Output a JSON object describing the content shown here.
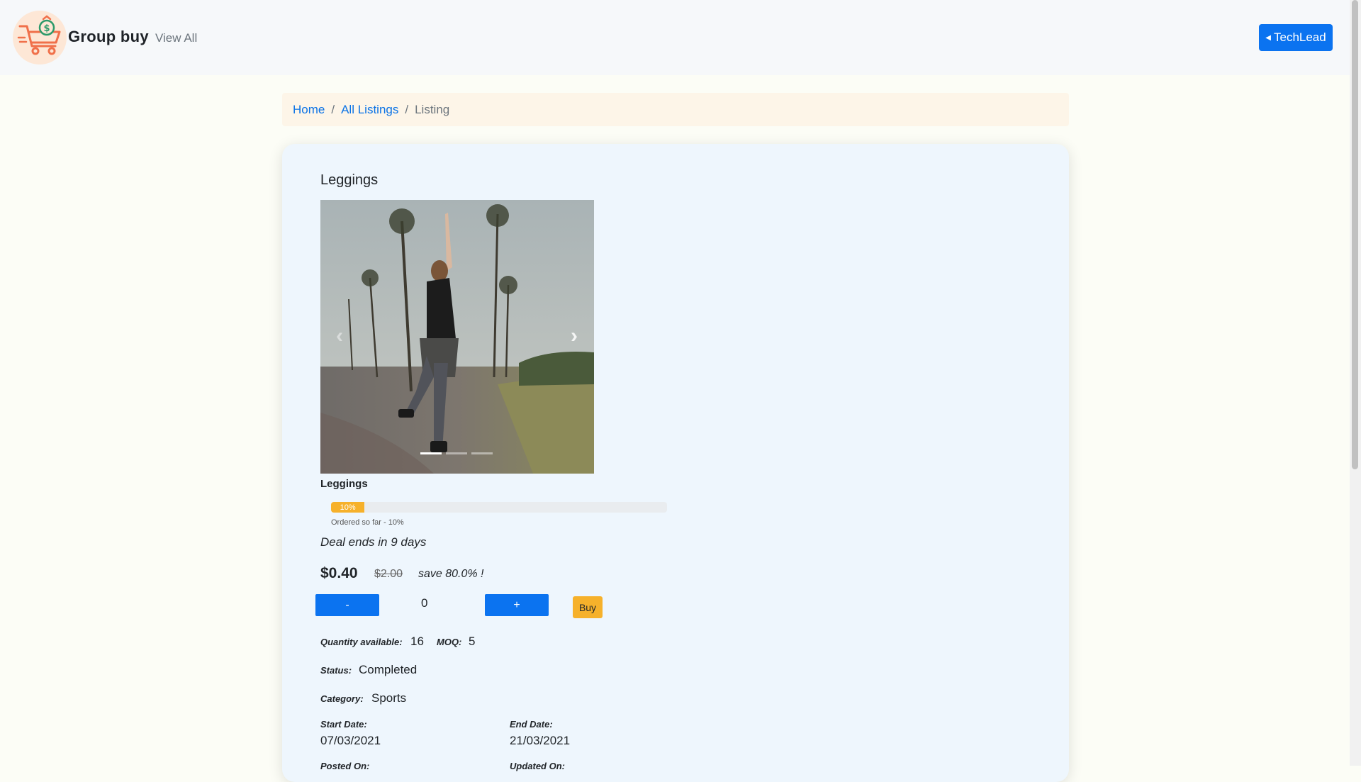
{
  "navbar": {
    "brand": "Group buy",
    "view_all": "View All",
    "user_button": "TechLead",
    "logo_icon": "shopping-cart-money-icon"
  },
  "breadcrumb": {
    "home": "Home",
    "all_listings": "All Listings",
    "current": "Listing",
    "separator": "/"
  },
  "listing": {
    "title": "Leggings",
    "product_name": "Leggings",
    "progress_percent": 10,
    "progress_label": "10%",
    "progress_caption": "Ordered so far - 10%",
    "deal_ends": "Deal ends in 9 days",
    "price": "$0.40",
    "original_price": "$2.00",
    "savings": "save 80.0% !",
    "quantity": "0",
    "minus_label": "-",
    "plus_label": "+",
    "buy_label": "Buy",
    "carousel": {
      "slide_count": 3,
      "active_slide": 0,
      "prev_icon": "chevron-left-icon",
      "next_icon": "chevron-right-icon"
    },
    "details": {
      "quantity_available_label": "Quantity available:",
      "quantity_available": "16",
      "moq_label": "MOQ:",
      "moq": "5",
      "status_label": "Status:",
      "status": "Completed",
      "category_label": "Category:",
      "category": "Sports",
      "start_date_label": "Start Date:",
      "start_date": "07/03/2021",
      "end_date_label": "End Date:",
      "end_date": "21/03/2021",
      "posted_on_label": "Posted On:",
      "updated_on_label": "Updated On:"
    }
  },
  "colors": {
    "primary": "#0b73f0",
    "warning": "#f6b12b",
    "card_bg": "#eef6fd",
    "breadcrumb_bg": "#fdf5e8"
  }
}
